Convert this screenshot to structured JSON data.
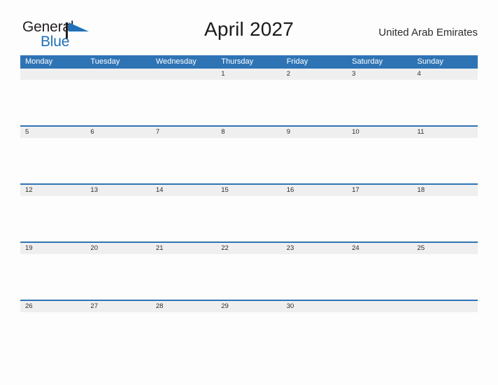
{
  "brand": {
    "name_part1": "General",
    "name_part2": "Blue",
    "flag_icon": "blue-triangle-flag-icon",
    "accent_color": "#2071b8"
  },
  "header": {
    "title": "April 2027",
    "locale": "United Arab Emirates"
  },
  "calendar": {
    "header_bg_color": "#2e74b5",
    "date_band_color": "#efefef",
    "weekdays": [
      "Monday",
      "Tuesday",
      "Wednesday",
      "Thursday",
      "Friday",
      "Saturday",
      "Sunday"
    ],
    "weeks": [
      [
        "",
        "",
        "",
        "1",
        "2",
        "3",
        "4"
      ],
      [
        "5",
        "6",
        "7",
        "8",
        "9",
        "10",
        "11"
      ],
      [
        "12",
        "13",
        "14",
        "15",
        "16",
        "17",
        "18"
      ],
      [
        "19",
        "20",
        "21",
        "22",
        "23",
        "24",
        "25"
      ],
      [
        "26",
        "27",
        "28",
        "29",
        "30",
        "",
        ""
      ]
    ],
    "events": [
      [
        "",
        "",
        "",
        "",
        "",
        "",
        ""
      ],
      [
        "",
        "",
        "",
        "",
        "",
        "",
        ""
      ],
      [
        "",
        "",
        "",
        "",
        "",
        "",
        ""
      ],
      [
        "",
        "",
        "",
        "",
        "",
        "",
        ""
      ],
      [
        "",
        "",
        "",
        "",
        "",
        "",
        ""
      ]
    ]
  }
}
